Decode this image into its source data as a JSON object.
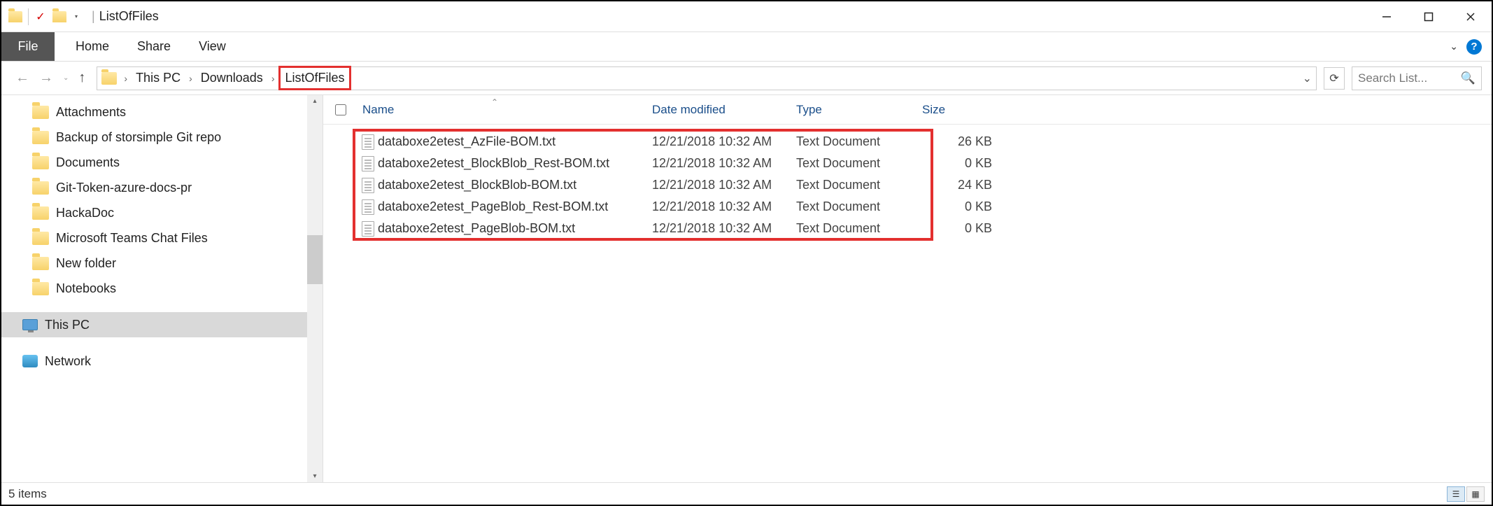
{
  "window": {
    "title": "ListOfFiles"
  },
  "ribbon": {
    "file": "File",
    "tabs": [
      "Home",
      "Share",
      "View"
    ]
  },
  "breadcrumb": {
    "items": [
      "This PC",
      "Downloads",
      "ListOfFiles"
    ],
    "highlighted_index": 2
  },
  "search": {
    "placeholder": "Search List..."
  },
  "sidebar": {
    "folders": [
      "Attachments",
      "Backup of storsimple Git repo",
      "Documents",
      "Git-Token-azure-docs-pr",
      "HackaDoc",
      "Microsoft Teams Chat Files",
      "New folder",
      "Notebooks"
    ],
    "this_pc": "This PC",
    "network": "Network"
  },
  "columns": {
    "name": "Name",
    "date": "Date modified",
    "type": "Type",
    "size": "Size"
  },
  "files": [
    {
      "name": "databoxe2etest_AzFile-BOM.txt",
      "date": "12/21/2018 10:32 AM",
      "type": "Text Document",
      "size": "26 KB"
    },
    {
      "name": "databoxe2etest_BlockBlob_Rest-BOM.txt",
      "date": "12/21/2018 10:32 AM",
      "type": "Text Document",
      "size": "0 KB"
    },
    {
      "name": "databoxe2etest_BlockBlob-BOM.txt",
      "date": "12/21/2018 10:32 AM",
      "type": "Text Document",
      "size": "24 KB"
    },
    {
      "name": "databoxe2etest_PageBlob_Rest-BOM.txt",
      "date": "12/21/2018 10:32 AM",
      "type": "Text Document",
      "size": "0 KB"
    },
    {
      "name": "databoxe2etest_PageBlob-BOM.txt",
      "date": "12/21/2018 10:32 AM",
      "type": "Text Document",
      "size": "0 KB"
    }
  ],
  "status": {
    "text": "5 items"
  }
}
